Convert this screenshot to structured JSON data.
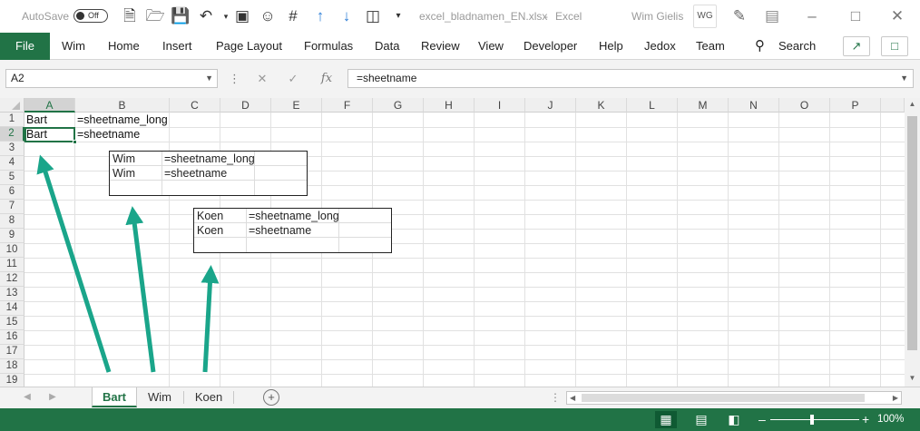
{
  "titlebar": {
    "autosave_label": "AutoSave",
    "autosave_state": "Off",
    "filename": "excel_bladnamen_EN.xlsx",
    "separator": "-",
    "app_name": "Excel",
    "user_name": "Wim Gielis",
    "user_initials": "WG"
  },
  "ribbon": {
    "file": "File",
    "tabs": [
      "Wim",
      "Home",
      "Insert",
      "Page Layout",
      "Formulas",
      "Data",
      "Review",
      "View",
      "Developer",
      "Help",
      "Jedox",
      "Team"
    ],
    "search": "Search"
  },
  "formula_bar": {
    "name_box": "A2",
    "fx": "fx",
    "formula": "=sheetname"
  },
  "grid": {
    "columns": [
      "A",
      "B",
      "C",
      "D",
      "E",
      "F",
      "G",
      "H",
      "I",
      "J",
      "K",
      "L",
      "M",
      "N",
      "O",
      "P"
    ],
    "rows": [
      "1",
      "2",
      "3",
      "4",
      "5",
      "6",
      "7",
      "8",
      "9",
      "10",
      "11",
      "12",
      "13",
      "14",
      "15",
      "16",
      "17",
      "18",
      "19"
    ],
    "selected_cell": "A2",
    "cells": {
      "A1": "Bart",
      "B1": "=sheetname_long",
      "A2": "Bart",
      "B2": "=sheetname"
    }
  },
  "panels": {
    "wim": {
      "r1c1": "Wim",
      "r1c2": "=sheetname_long",
      "r2c1": "Wim",
      "r2c2": "=sheetname"
    },
    "koen": {
      "r1c1": "Koen",
      "r1c2": "=sheetname_long",
      "r2c1": "Koen",
      "r2c2": "=sheetname"
    }
  },
  "annotations": {
    "arrow_color": "#1aa58a"
  },
  "sheets": {
    "tabs": [
      "Bart",
      "Wim",
      "Koen"
    ],
    "active": "Bart"
  },
  "statusbar": {
    "zoom": "100%"
  },
  "colors": {
    "excel_green": "#217346"
  }
}
